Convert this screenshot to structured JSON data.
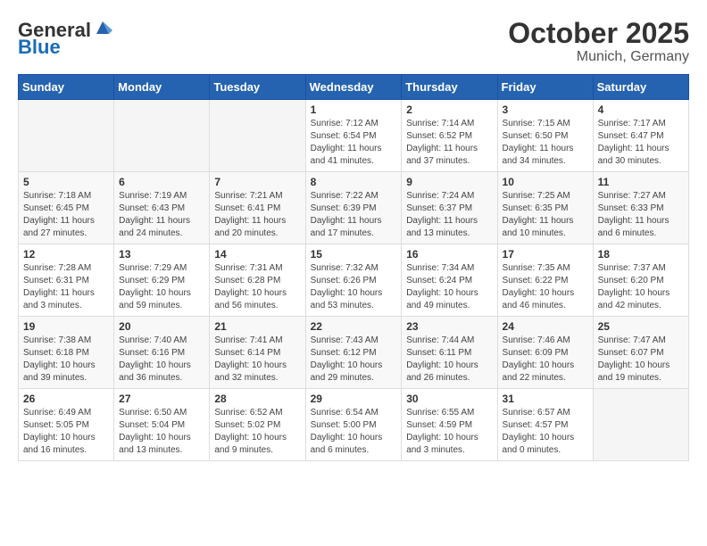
{
  "header": {
    "logo_general": "General",
    "logo_blue": "Blue",
    "month_title": "October 2025",
    "location": "Munich, Germany"
  },
  "weekdays": [
    "Sunday",
    "Monday",
    "Tuesday",
    "Wednesday",
    "Thursday",
    "Friday",
    "Saturday"
  ],
  "weeks": [
    [
      {
        "day": "",
        "info": ""
      },
      {
        "day": "",
        "info": ""
      },
      {
        "day": "",
        "info": ""
      },
      {
        "day": "1",
        "info": "Sunrise: 7:12 AM\nSunset: 6:54 PM\nDaylight: 11 hours\nand 41 minutes."
      },
      {
        "day": "2",
        "info": "Sunrise: 7:14 AM\nSunset: 6:52 PM\nDaylight: 11 hours\nand 37 minutes."
      },
      {
        "day": "3",
        "info": "Sunrise: 7:15 AM\nSunset: 6:50 PM\nDaylight: 11 hours\nand 34 minutes."
      },
      {
        "day": "4",
        "info": "Sunrise: 7:17 AM\nSunset: 6:47 PM\nDaylight: 11 hours\nand 30 minutes."
      }
    ],
    [
      {
        "day": "5",
        "info": "Sunrise: 7:18 AM\nSunset: 6:45 PM\nDaylight: 11 hours\nand 27 minutes."
      },
      {
        "day": "6",
        "info": "Sunrise: 7:19 AM\nSunset: 6:43 PM\nDaylight: 11 hours\nand 24 minutes."
      },
      {
        "day": "7",
        "info": "Sunrise: 7:21 AM\nSunset: 6:41 PM\nDaylight: 11 hours\nand 20 minutes."
      },
      {
        "day": "8",
        "info": "Sunrise: 7:22 AM\nSunset: 6:39 PM\nDaylight: 11 hours\nand 17 minutes."
      },
      {
        "day": "9",
        "info": "Sunrise: 7:24 AM\nSunset: 6:37 PM\nDaylight: 11 hours\nand 13 minutes."
      },
      {
        "day": "10",
        "info": "Sunrise: 7:25 AM\nSunset: 6:35 PM\nDaylight: 11 hours\nand 10 minutes."
      },
      {
        "day": "11",
        "info": "Sunrise: 7:27 AM\nSunset: 6:33 PM\nDaylight: 11 hours\nand 6 minutes."
      }
    ],
    [
      {
        "day": "12",
        "info": "Sunrise: 7:28 AM\nSunset: 6:31 PM\nDaylight: 11 hours\nand 3 minutes."
      },
      {
        "day": "13",
        "info": "Sunrise: 7:29 AM\nSunset: 6:29 PM\nDaylight: 10 hours\nand 59 minutes."
      },
      {
        "day": "14",
        "info": "Sunrise: 7:31 AM\nSunset: 6:28 PM\nDaylight: 10 hours\nand 56 minutes."
      },
      {
        "day": "15",
        "info": "Sunrise: 7:32 AM\nSunset: 6:26 PM\nDaylight: 10 hours\nand 53 minutes."
      },
      {
        "day": "16",
        "info": "Sunrise: 7:34 AM\nSunset: 6:24 PM\nDaylight: 10 hours\nand 49 minutes."
      },
      {
        "day": "17",
        "info": "Sunrise: 7:35 AM\nSunset: 6:22 PM\nDaylight: 10 hours\nand 46 minutes."
      },
      {
        "day": "18",
        "info": "Sunrise: 7:37 AM\nSunset: 6:20 PM\nDaylight: 10 hours\nand 42 minutes."
      }
    ],
    [
      {
        "day": "19",
        "info": "Sunrise: 7:38 AM\nSunset: 6:18 PM\nDaylight: 10 hours\nand 39 minutes."
      },
      {
        "day": "20",
        "info": "Sunrise: 7:40 AM\nSunset: 6:16 PM\nDaylight: 10 hours\nand 36 minutes."
      },
      {
        "day": "21",
        "info": "Sunrise: 7:41 AM\nSunset: 6:14 PM\nDaylight: 10 hours\nand 32 minutes."
      },
      {
        "day": "22",
        "info": "Sunrise: 7:43 AM\nSunset: 6:12 PM\nDaylight: 10 hours\nand 29 minutes."
      },
      {
        "day": "23",
        "info": "Sunrise: 7:44 AM\nSunset: 6:11 PM\nDaylight: 10 hours\nand 26 minutes."
      },
      {
        "day": "24",
        "info": "Sunrise: 7:46 AM\nSunset: 6:09 PM\nDaylight: 10 hours\nand 22 minutes."
      },
      {
        "day": "25",
        "info": "Sunrise: 7:47 AM\nSunset: 6:07 PM\nDaylight: 10 hours\nand 19 minutes."
      }
    ],
    [
      {
        "day": "26",
        "info": "Sunrise: 6:49 AM\nSunset: 5:05 PM\nDaylight: 10 hours\nand 16 minutes."
      },
      {
        "day": "27",
        "info": "Sunrise: 6:50 AM\nSunset: 5:04 PM\nDaylight: 10 hours\nand 13 minutes."
      },
      {
        "day": "28",
        "info": "Sunrise: 6:52 AM\nSunset: 5:02 PM\nDaylight: 10 hours\nand 9 minutes."
      },
      {
        "day": "29",
        "info": "Sunrise: 6:54 AM\nSunset: 5:00 PM\nDaylight: 10 hours\nand 6 minutes."
      },
      {
        "day": "30",
        "info": "Sunrise: 6:55 AM\nSunset: 4:59 PM\nDaylight: 10 hours\nand 3 minutes."
      },
      {
        "day": "31",
        "info": "Sunrise: 6:57 AM\nSunset: 4:57 PM\nDaylight: 10 hours\nand 0 minutes."
      },
      {
        "day": "",
        "info": ""
      }
    ]
  ]
}
